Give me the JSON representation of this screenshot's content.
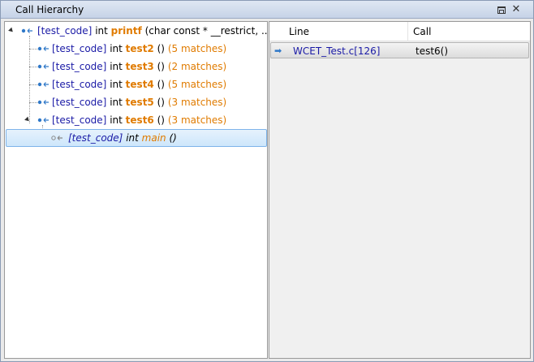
{
  "window": {
    "title": "Call Hierarchy"
  },
  "tree": {
    "root": {
      "tag": "[test_code]",
      "kw": "int",
      "fn": "printf",
      "args": "(char const * __restrict, ...)"
    },
    "children": [
      {
        "tag": "[test_code]",
        "kw": "int",
        "fn": "test2",
        "args": "()",
        "matches": "(5 matches)"
      },
      {
        "tag": "[test_code]",
        "kw": "int",
        "fn": "test3",
        "args": "()",
        "matches": "(2 matches)"
      },
      {
        "tag": "[test_code]",
        "kw": "int",
        "fn": "test4",
        "args": "()",
        "matches": "(5 matches)"
      },
      {
        "tag": "[test_code]",
        "kw": "int",
        "fn": "test5",
        "args": "()",
        "matches": "(3 matches)"
      },
      {
        "tag": "[test_code]",
        "kw": "int",
        "fn": "test6",
        "args": "()",
        "matches": "(3 matches)"
      }
    ],
    "grandchild": {
      "tag": "[test_code]",
      "kw": "int",
      "fn": "main",
      "args": "()"
    }
  },
  "table": {
    "columns": [
      "Line",
      "Call"
    ],
    "rows": [
      {
        "line": "WCET_Test.c[126]",
        "call": "test6()"
      }
    ]
  },
  "colors": {
    "accent": "#e07b00",
    "tag": "#1a1aa6",
    "selection": "#cde6fb"
  }
}
